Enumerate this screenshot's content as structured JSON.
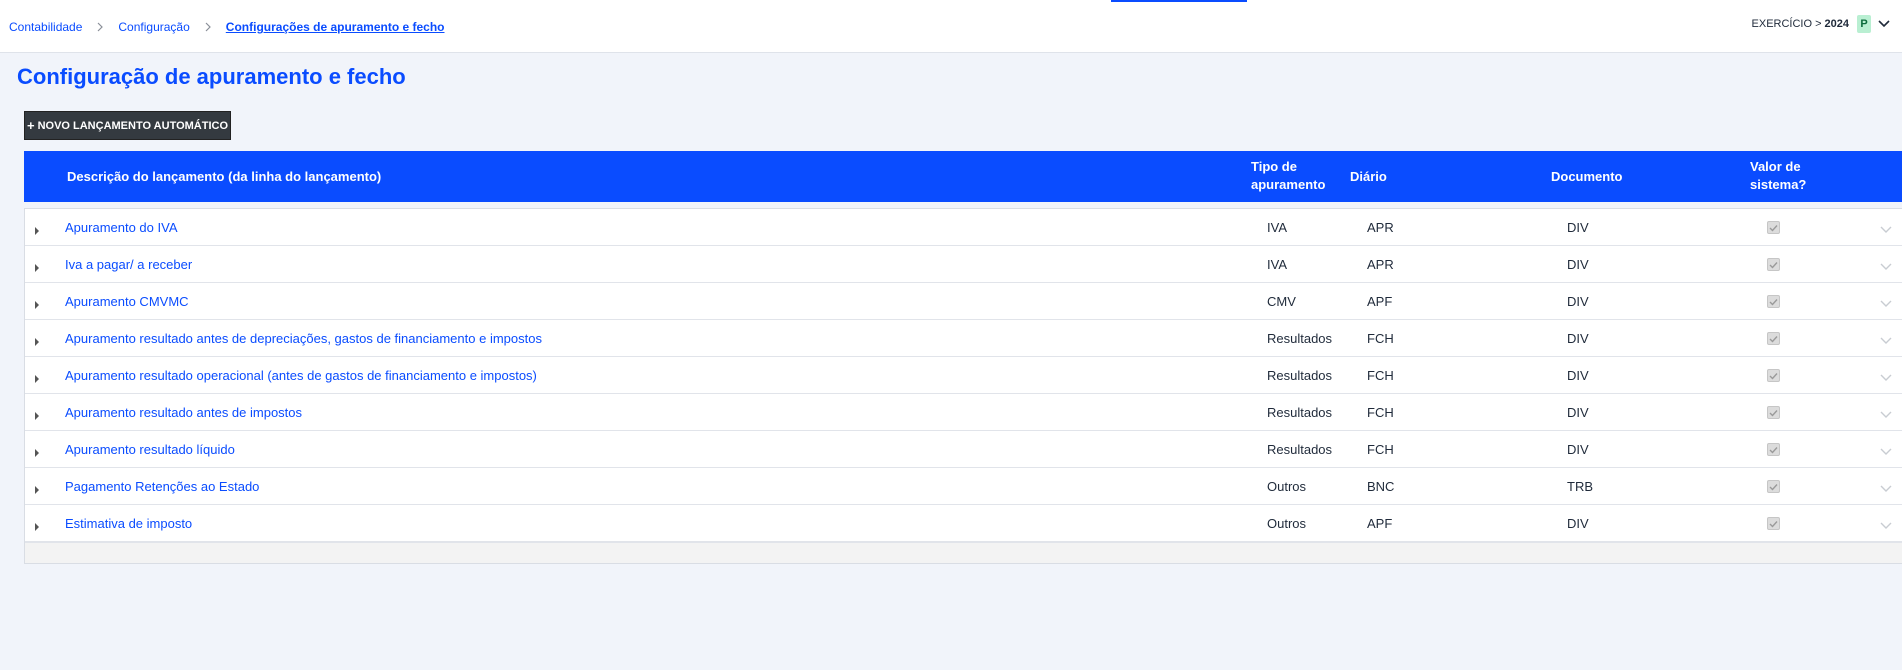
{
  "breadcrumb": {
    "items": [
      "Contabilidade",
      "Configuração",
      "Configurações de apuramento e fecho"
    ]
  },
  "exercise": {
    "label": "EXERCÍCIO >",
    "year": "2024",
    "badge": "P"
  },
  "page": {
    "title": "Configuração de apuramento e fecho"
  },
  "toolbar": {
    "new_button_icon": "+",
    "new_button_label": "NOVO LANÇAMENTO AUTOMÁTICO"
  },
  "table": {
    "headers": {
      "description": "Descrição do lançamento (da linha do lançamento)",
      "tipo": "Tipo de apuramento",
      "diario": "Diário",
      "documento": "Documento",
      "valor": "Valor de sistema?"
    },
    "rows": [
      {
        "description": "Apuramento do IVA",
        "tipo": "IVA",
        "diario": "APR",
        "documento": "DIV",
        "system_value": true
      },
      {
        "description": "Iva a pagar/ a receber",
        "tipo": "IVA",
        "diario": "APR",
        "documento": "DIV",
        "system_value": true
      },
      {
        "description": "Apuramento CMVMC",
        "tipo": "CMV",
        "diario": "APF",
        "documento": "DIV",
        "system_value": true
      },
      {
        "description": "Apuramento resultado antes de depreciações, gastos de financiamento e impostos",
        "tipo": "Resultados",
        "diario": "FCH",
        "documento": "DIV",
        "system_value": true
      },
      {
        "description": "Apuramento resultado operacional (antes de gastos de financiamento e impostos)",
        "tipo": "Resultados",
        "diario": "FCH",
        "documento": "DIV",
        "system_value": true
      },
      {
        "description": "Apuramento resultado antes de impostos",
        "tipo": "Resultados",
        "diario": "FCH",
        "documento": "DIV",
        "system_value": true
      },
      {
        "description": "Apuramento resultado líquido",
        "tipo": "Resultados",
        "diario": "FCH",
        "documento": "DIV",
        "system_value": true
      },
      {
        "description": "Pagamento Retenções ao Estado",
        "tipo": "Outros",
        "diario": "BNC",
        "documento": "TRB",
        "system_value": true
      },
      {
        "description": "Estimativa de imposto",
        "tipo": "Outros",
        "diario": "APF",
        "documento": "DIV",
        "system_value": true
      }
    ]
  },
  "colors": {
    "accent": "#0a4cff",
    "background": "#f1f4fa",
    "button_dark": "#343a40",
    "badge_bg": "#b9efd2"
  },
  "icons": {
    "breadcrumb_separator": "chevron-right-icon",
    "exercise_toggle": "chevron-down-icon",
    "row_expand": "caret-right-icon",
    "row_menu": "chevron-down-icon",
    "new_button": "plus-icon"
  }
}
